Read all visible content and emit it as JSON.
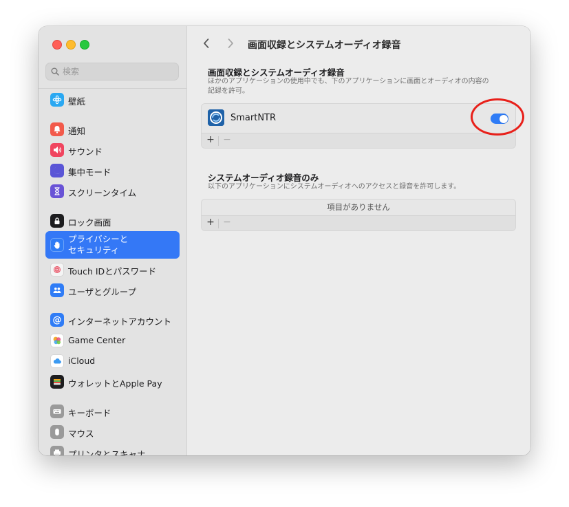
{
  "search": {
    "placeholder": "検索"
  },
  "sidebar": {
    "items": [
      {
        "label": "壁紙",
        "icon": "wallpaper-icon",
        "color": "#2aa8f2"
      },
      {
        "label": "通知",
        "icon": "bell-icon",
        "color": "#f25a4b"
      },
      {
        "label": "サウンド",
        "icon": "speaker-icon",
        "color": "#f0455f"
      },
      {
        "label": "集中モード",
        "icon": "moon-icon",
        "color": "#5a55d6"
      },
      {
        "label": "スクリーンタイム",
        "icon": "hourglass-icon",
        "color": "#6953d6"
      },
      {
        "label": "ロック画面",
        "icon": "lock-icon",
        "color": "#1d1d1f"
      },
      {
        "label": "プライバシーと\nセキュリティ",
        "icon": "hand-icon",
        "color": "#2f7cf6",
        "active": true
      },
      {
        "label": "Touch IDとパスワード",
        "icon": "fingerprint-icon",
        "color": "#f2f2f2"
      },
      {
        "label": "ユーザとグループ",
        "icon": "users-icon",
        "color": "#2f7cf6"
      },
      {
        "label": "インターネットアカウント",
        "icon": "at-icon",
        "color": "#2f7cf6"
      },
      {
        "label": "Game Center",
        "icon": "game-center-icon",
        "color": "#ffffff"
      },
      {
        "label": "iCloud",
        "icon": "cloud-icon",
        "color": "#ffffff"
      },
      {
        "label": "ウォレットとApple Pay",
        "icon": "wallet-icon",
        "color": "#1d1d1f"
      },
      {
        "label": "キーボード",
        "icon": "keyboard-icon",
        "color": "#9a9a9a"
      },
      {
        "label": "マウス",
        "icon": "mouse-icon",
        "color": "#9a9a9a"
      },
      {
        "label": "プリンタとスキャナ",
        "icon": "printer-icon",
        "color": "#9a9a9a"
      }
    ]
  },
  "header": {
    "title": "画面収録とシステムオーディオ録音"
  },
  "section1": {
    "title": "画面収録とシステムオーディオ録音",
    "description": "ほかのアプリケーションの使用中でも、下のアプリケーションに画面とオーディオの内容の記録を許可。",
    "apps": [
      {
        "name": "SmartNTR",
        "enabled": true
      }
    ]
  },
  "section2": {
    "title": "システムオーディオ録音のみ",
    "description": "以下のアプリケーションにシステムオーディオへのアクセスと録音を許可します。",
    "empty_text": "項目がありません"
  },
  "controls": {
    "plus": "+",
    "minus": "−"
  },
  "colors": {
    "accent": "#2f7cf6",
    "highlight_circle": "#e8201a"
  }
}
